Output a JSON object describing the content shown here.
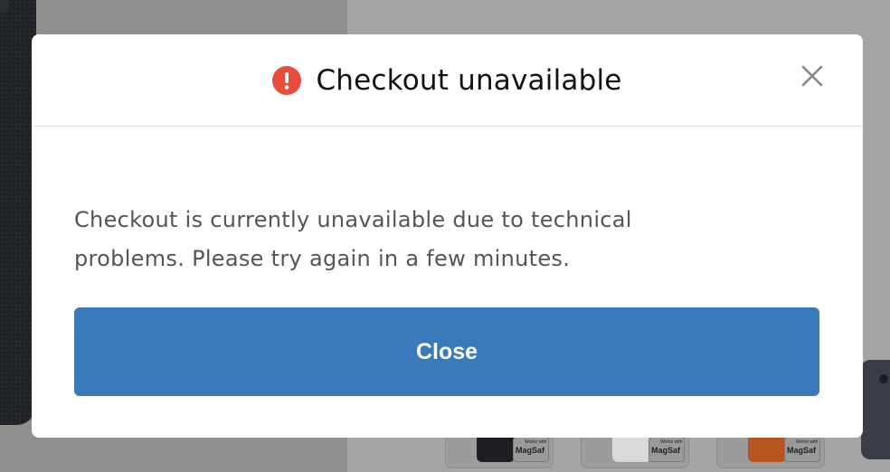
{
  "background": {
    "thumbnails": [
      {
        "badge_small": "Works with",
        "badge_big": "MagSaf",
        "case_color": "#1e1f22"
      },
      {
        "badge_small": "Works with",
        "badge_big": "MagSaf",
        "case_color": "#e3e3e3"
      },
      {
        "badge_small": "Works with",
        "badge_big": "MagSaf",
        "case_color": "#c8521f"
      }
    ]
  },
  "modal": {
    "title": "Checkout unavailable",
    "icon": "alert-circle-icon",
    "accent_color": "#e74c3c",
    "message": "Checkout is currently unavailable due to technical problems. Please try again in a few minutes.",
    "close_button_label": "Close",
    "close_button_color": "#3a7abb"
  }
}
